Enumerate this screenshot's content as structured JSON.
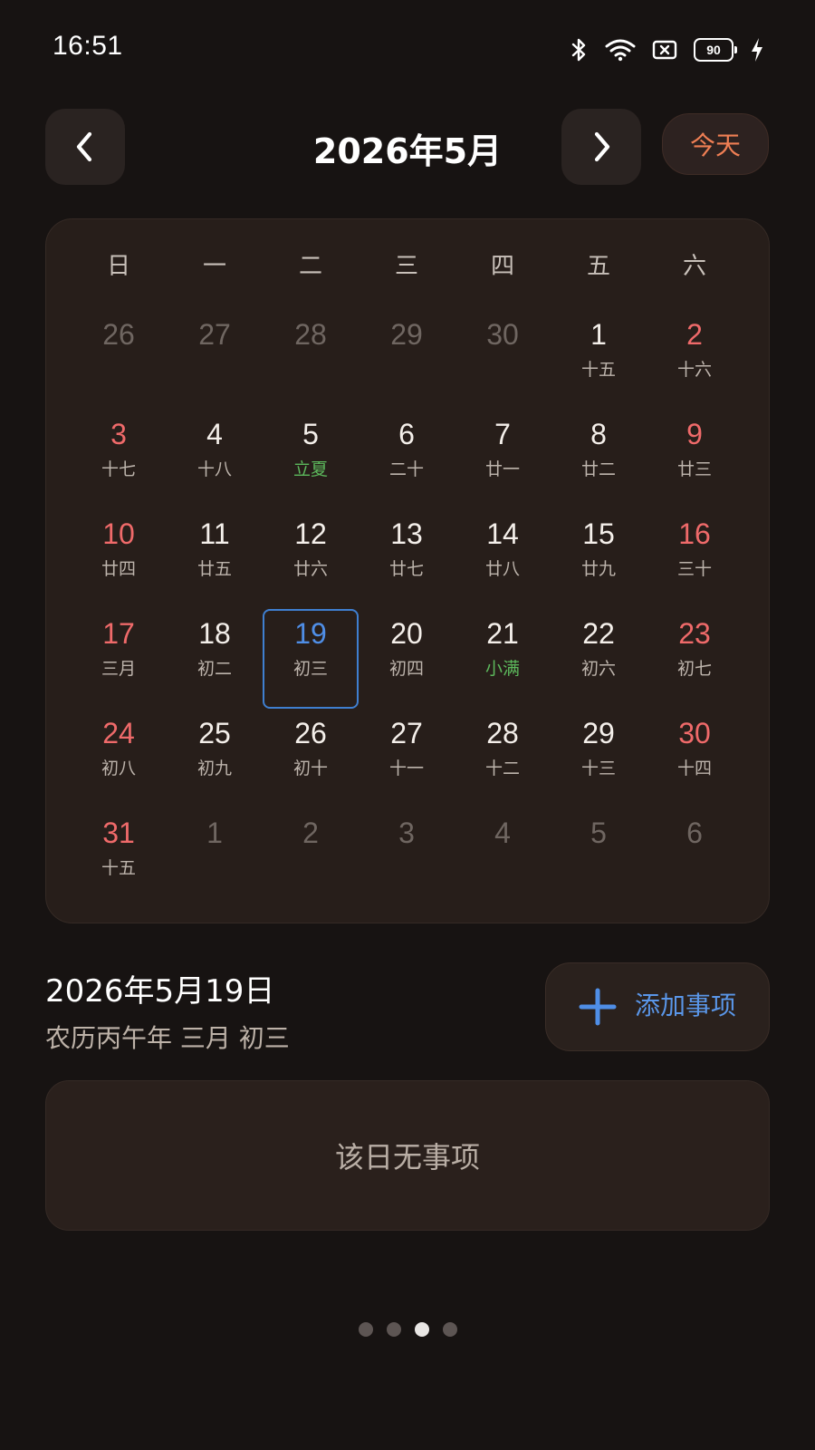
{
  "status_bar": {
    "time": "16:51",
    "battery_level": "90",
    "icons": [
      "bluetooth-icon",
      "wifi-icon",
      "sim-icon",
      "battery-icon",
      "charging-icon"
    ]
  },
  "header": {
    "month_title": "2026年5月",
    "prev_icon": "chevron-left-icon",
    "next_icon": "chevron-right-icon",
    "today_label": "今天"
  },
  "calendar": {
    "weekdays": [
      "日",
      "一",
      "二",
      "三",
      "四",
      "五",
      "六"
    ],
    "days": [
      {
        "num": "26",
        "lunar": "",
        "type": "other"
      },
      {
        "num": "27",
        "lunar": "",
        "type": "other"
      },
      {
        "num": "28",
        "lunar": "",
        "type": "other"
      },
      {
        "num": "29",
        "lunar": "",
        "type": "other"
      },
      {
        "num": "30",
        "lunar": "",
        "type": "other"
      },
      {
        "num": "1",
        "lunar": "十五",
        "type": "normal"
      },
      {
        "num": "2",
        "lunar": "十六",
        "type": "weekend"
      },
      {
        "num": "3",
        "lunar": "十七",
        "type": "weekend"
      },
      {
        "num": "4",
        "lunar": "十八",
        "type": "normal"
      },
      {
        "num": "5",
        "lunar": "立夏",
        "type": "term"
      },
      {
        "num": "6",
        "lunar": "二十",
        "type": "normal"
      },
      {
        "num": "7",
        "lunar": "廿一",
        "type": "normal"
      },
      {
        "num": "8",
        "lunar": "廿二",
        "type": "normal"
      },
      {
        "num": "9",
        "lunar": "廿三",
        "type": "weekend"
      },
      {
        "num": "10",
        "lunar": "廿四",
        "type": "weekend"
      },
      {
        "num": "11",
        "lunar": "廿五",
        "type": "normal"
      },
      {
        "num": "12",
        "lunar": "廿六",
        "type": "normal"
      },
      {
        "num": "13",
        "lunar": "廿七",
        "type": "normal"
      },
      {
        "num": "14",
        "lunar": "廿八",
        "type": "normal"
      },
      {
        "num": "15",
        "lunar": "廿九",
        "type": "normal"
      },
      {
        "num": "16",
        "lunar": "三十",
        "type": "weekend"
      },
      {
        "num": "17",
        "lunar": "三月",
        "type": "weekend"
      },
      {
        "num": "18",
        "lunar": "初二",
        "type": "normal"
      },
      {
        "num": "19",
        "lunar": "初三",
        "type": "selected"
      },
      {
        "num": "20",
        "lunar": "初四",
        "type": "normal"
      },
      {
        "num": "21",
        "lunar": "小满",
        "type": "term"
      },
      {
        "num": "22",
        "lunar": "初六",
        "type": "normal"
      },
      {
        "num": "23",
        "lunar": "初七",
        "type": "weekend"
      },
      {
        "num": "24",
        "lunar": "初八",
        "type": "weekend"
      },
      {
        "num": "25",
        "lunar": "初九",
        "type": "normal"
      },
      {
        "num": "26",
        "lunar": "初十",
        "type": "normal"
      },
      {
        "num": "27",
        "lunar": "十一",
        "type": "normal"
      },
      {
        "num": "28",
        "lunar": "十二",
        "type": "normal"
      },
      {
        "num": "29",
        "lunar": "十三",
        "type": "normal"
      },
      {
        "num": "30",
        "lunar": "十四",
        "type": "weekend"
      },
      {
        "num": "31",
        "lunar": "十五",
        "type": "weekend"
      },
      {
        "num": "1",
        "lunar": "",
        "type": "other"
      },
      {
        "num": "2",
        "lunar": "",
        "type": "other"
      },
      {
        "num": "3",
        "lunar": "",
        "type": "other"
      },
      {
        "num": "4",
        "lunar": "",
        "type": "other"
      },
      {
        "num": "5",
        "lunar": "",
        "type": "other"
      },
      {
        "num": "6",
        "lunar": "",
        "type": "other"
      }
    ]
  },
  "selected": {
    "date": "2026年5月19日",
    "lunar": "农历丙午年 三月 初三"
  },
  "add_button": {
    "label": "添加事项",
    "icon": "plus-icon"
  },
  "events": {
    "empty_text": "该日无事项"
  },
  "pager": {
    "count": 4,
    "active_index": 2
  },
  "colors": {
    "background": "#171312",
    "card": "#271e1a",
    "accent_orange": "#ef7f54",
    "accent_blue": "#4f8ee6",
    "weekend_red": "#ef6a6a",
    "solar_term_green": "#5cb85c"
  }
}
